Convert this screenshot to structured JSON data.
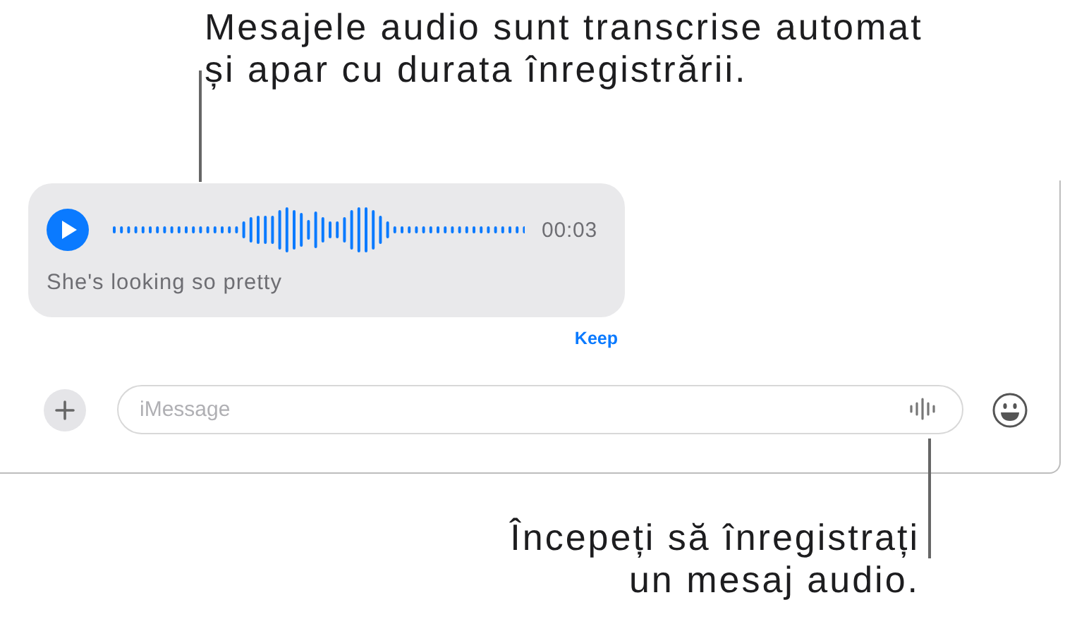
{
  "callouts": [
    {
      "text": "Mesajele audio sunt transcrise automat\nși apar cu durata înregistrării."
    },
    {
      "text": "Începeți să înregistrați\nun mesaj audio."
    }
  ],
  "audio_message": {
    "duration": "00:03",
    "transcript": "She's looking so pretty",
    "action": "Keep"
  },
  "composer": {
    "placeholder": "iMessage"
  }
}
